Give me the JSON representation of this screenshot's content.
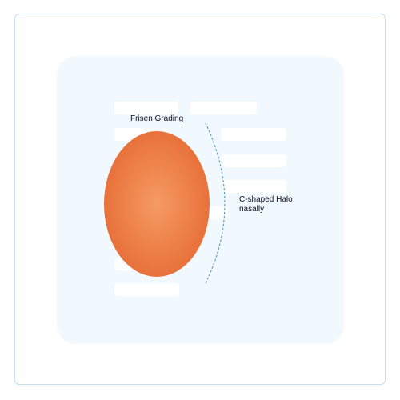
{
  "diagram": {
    "title": "Frisen Grading",
    "halo_label_line1": "C-shaped Halo",
    "halo_label_line2": "nasally",
    "colors": {
      "disc_center": "#f59b63",
      "disc_edge": "#e8713a",
      "halo_stroke": "#5aa0c8",
      "frame_border": "#c6dcf0",
      "panel_background": "#f2f9fe"
    }
  }
}
